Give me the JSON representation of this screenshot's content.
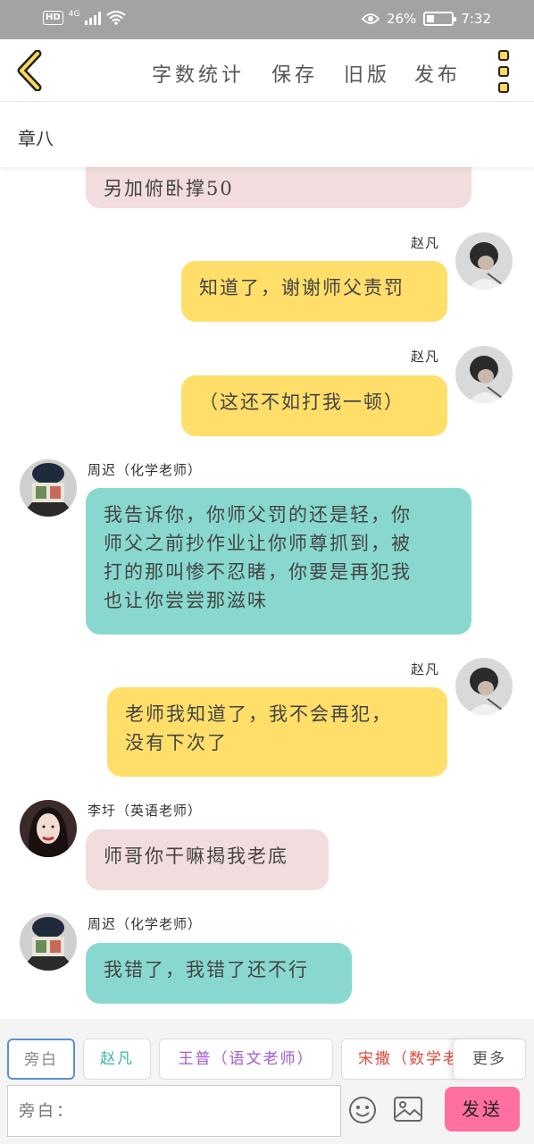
{
  "status_bar": {
    "network_badge": "HD",
    "network_type": "4G",
    "battery_percent": "26%",
    "time": "7:32"
  },
  "toolbar": {
    "word_count": "字数统计",
    "save": "保存",
    "old_version": "旧版",
    "publish": "发布"
  },
  "chapter": {
    "title": "章八"
  },
  "messages": [
    {
      "side": "left",
      "color": "pink",
      "name": "",
      "text": "另加俯卧撑50"
    },
    {
      "side": "right",
      "color": "yellow",
      "name": "赵凡",
      "text": "知道了，谢谢师父责罚"
    },
    {
      "side": "right",
      "color": "yellow",
      "name": "赵凡",
      "text": "（这还不如打我一顿）"
    },
    {
      "side": "left",
      "color": "teal",
      "name": "周迟（化学老师）",
      "lines": [
        "我告诉你，你师父罚的还是轻，你",
        "师父之前抄作业让你师尊抓到，被",
        "打的那叫惨不忍睹，你要是再犯我",
        "也让你尝尝那滋味"
      ]
    },
    {
      "side": "right",
      "color": "yellow",
      "name": "赵凡",
      "lines": [
        "老师我知道了，我不会再犯，",
        "没有下次了"
      ]
    },
    {
      "side": "left",
      "color": "pink",
      "name": "李圩（英语老师）",
      "text": "师哥你干嘛揭我老底"
    },
    {
      "side": "left",
      "color": "teal",
      "name": "周迟（化学老师）",
      "text": "我错了，我错了还不行"
    }
  ],
  "roles": [
    {
      "label": "旁白",
      "color": "#888888"
    },
    {
      "label": "赵凡",
      "color": "#3ab5a8"
    },
    {
      "label": "王普（语文老师）",
      "color": "#a25bd0"
    },
    {
      "label": "宋撒（数学老",
      "color": "#d94a3a"
    },
    {
      "label": "更多",
      "color": "#555555"
    }
  ],
  "input": {
    "placeholder": "旁白："
  },
  "send_label": "发送",
  "colors": {
    "status_bar": "#a3a3a3",
    "yellow_bubble": "#ffde6a",
    "teal_bubble": "#88d8cf",
    "pink_bubble": "#f2dcdd",
    "send_button": "#ff6fa0"
  }
}
